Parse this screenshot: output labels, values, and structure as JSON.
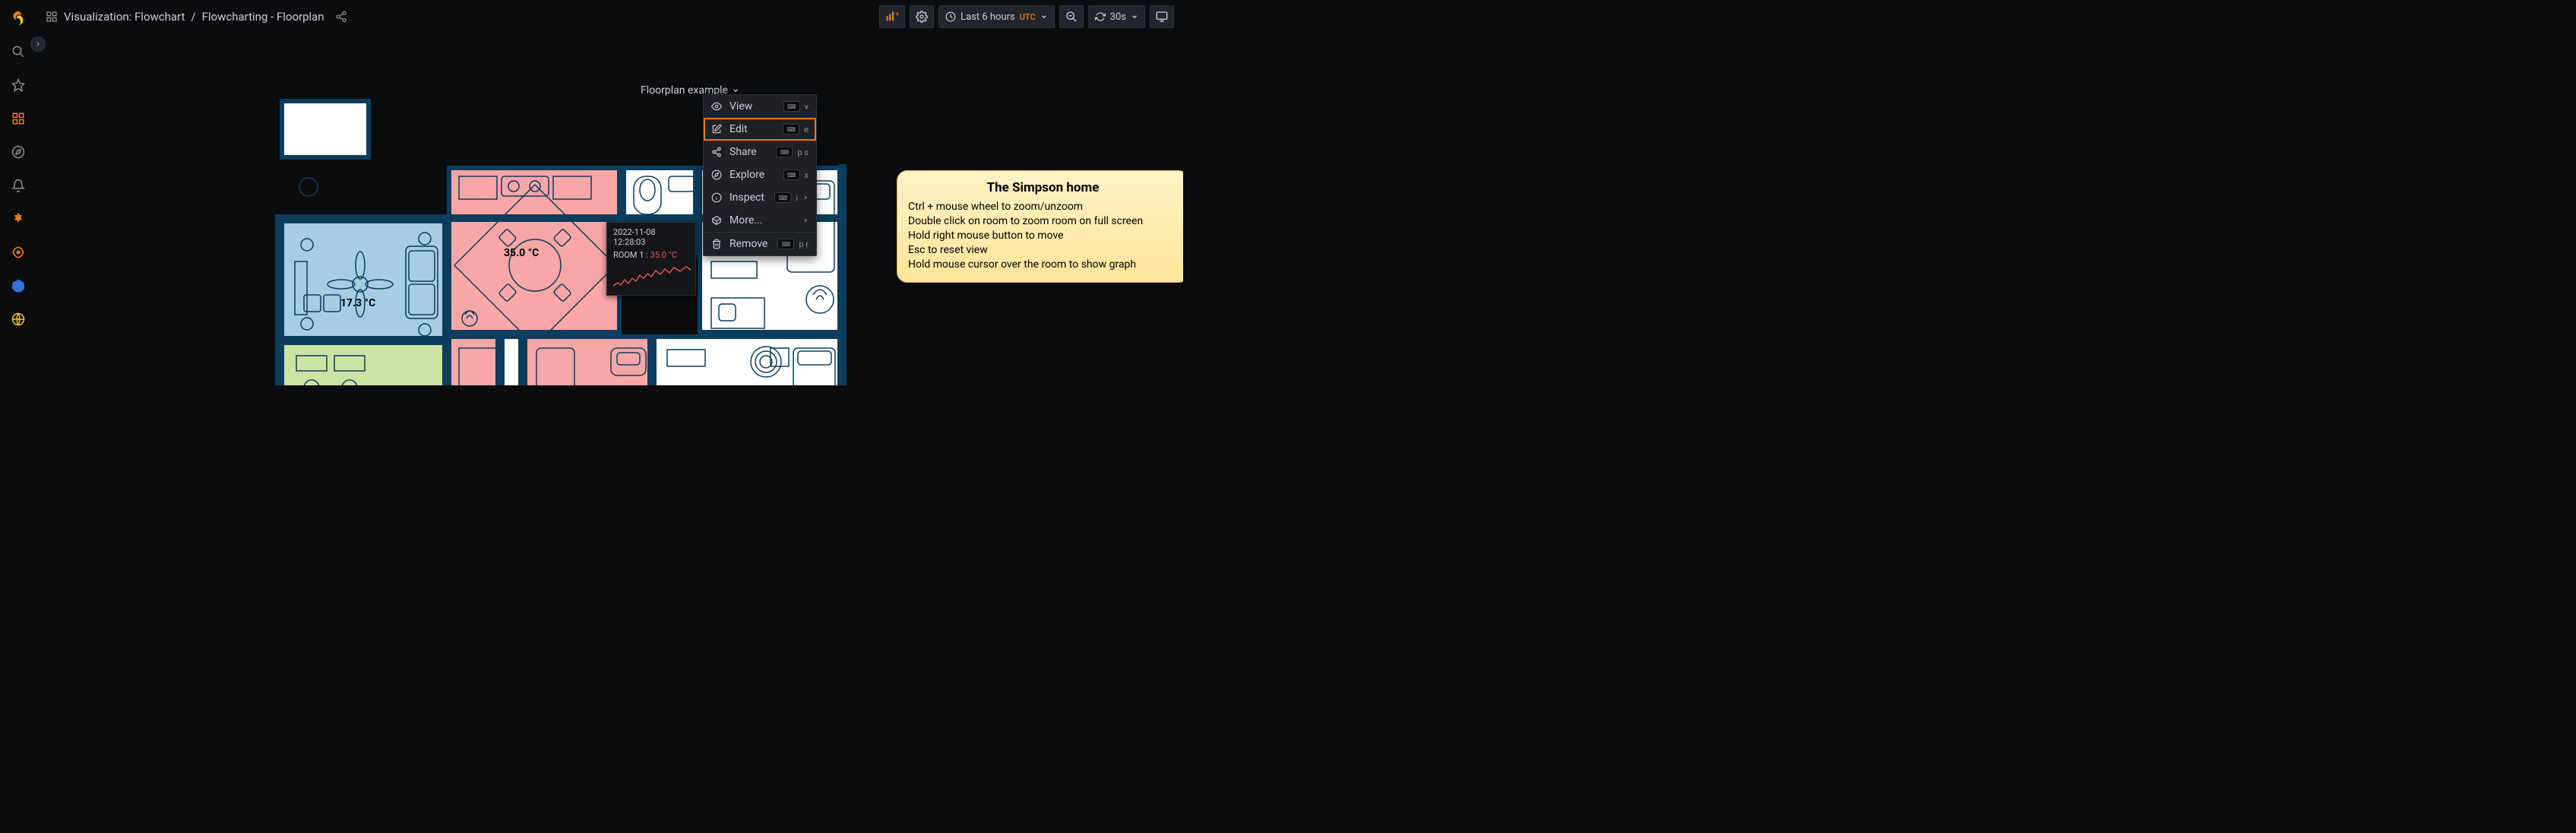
{
  "breadcrumb": {
    "parent": "Visualization: Flowchart",
    "current": "Flowcharting - Floorplan"
  },
  "toolbar": {
    "time_range": "Last 6 hours",
    "utc": "UTC",
    "refresh": "30s"
  },
  "panel": {
    "title": "Floorplan example"
  },
  "menu": {
    "view": "View",
    "edit": "Edit",
    "share": "Share",
    "explore": "Explore",
    "inspect": "Inspect",
    "more": "More...",
    "remove": "Remove",
    "view_key": "v",
    "edit_key": "e",
    "share_key": "p s",
    "explore_key": "x",
    "inspect_key": "i",
    "remove_key": "p r"
  },
  "rooms": {
    "room1_temp": "35.0 °C",
    "room2_temp": "17.3 °C"
  },
  "tooltip": {
    "timestamp": "2022-11-08 12:28:03",
    "series": "ROOM 1 :",
    "value": "35.0 °C"
  },
  "info": {
    "title": "The Simpson home",
    "line1": "Ctrl + mouse wheel to zoom/unzoom",
    "line2": "Double click on room to zoom room on full screen",
    "line3": "Hold right mouse button to move",
    "line4": "Esc to reset view",
    "line5": "Hold mouse cursor over the room to show graph"
  }
}
